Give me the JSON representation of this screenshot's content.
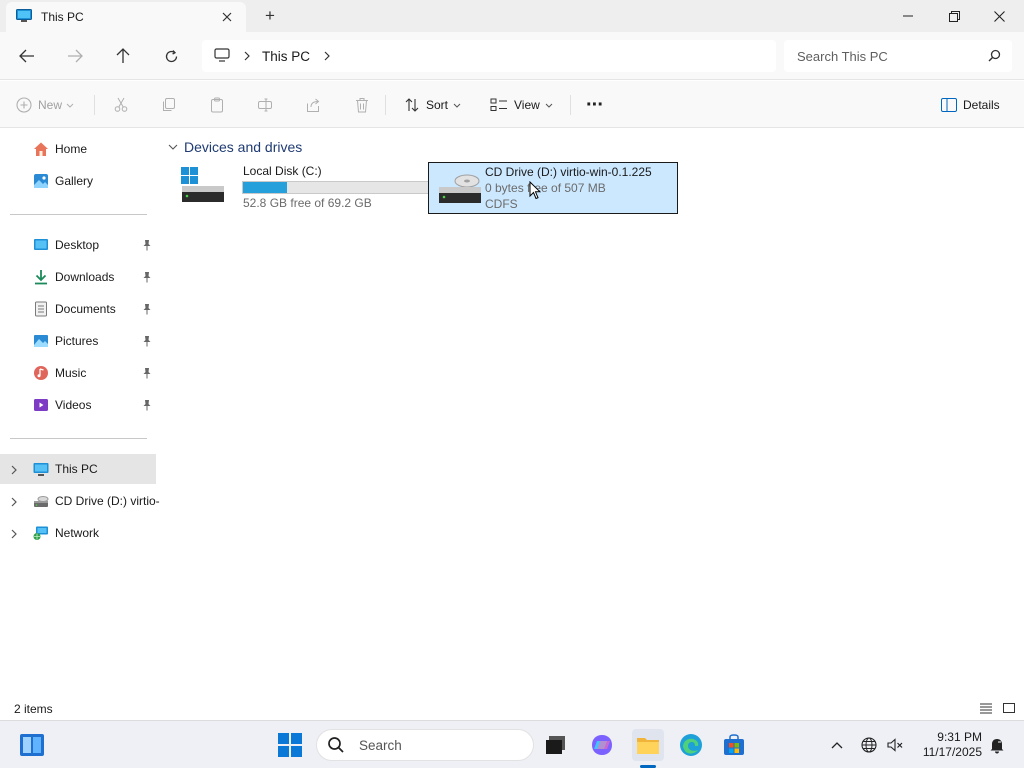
{
  "window": {
    "tab_title": "This PC",
    "new_tab_symbol": "+"
  },
  "address": {
    "crumbs": [
      "This PC"
    ],
    "search_placeholder": "Search This PC"
  },
  "commands": {
    "new_label": "New",
    "sort_label": "Sort",
    "view_label": "View",
    "more_symbol": "···",
    "details_label": "Details"
  },
  "sidebar": {
    "home": "Home",
    "gallery": "Gallery",
    "pinned": [
      {
        "label": "Desktop",
        "icon": "desktop-icon"
      },
      {
        "label": "Downloads",
        "icon": "downloads-icon"
      },
      {
        "label": "Documents",
        "icon": "documents-icon"
      },
      {
        "label": "Pictures",
        "icon": "pictures-icon"
      },
      {
        "label": "Music",
        "icon": "music-icon"
      },
      {
        "label": "Videos",
        "icon": "videos-icon"
      }
    ],
    "this_pc": "This PC",
    "cd_drive": "CD Drive (D:) virtio-",
    "network": "Network"
  },
  "main": {
    "group_title": "Devices and drives",
    "drives": [
      {
        "name": "Local Disk (C:)",
        "free_text": "52.8 GB free of 69.2 GB",
        "used_fraction": 0.237
      },
      {
        "name": "CD Drive (D:) virtio-win-0.1.225",
        "free_text": "0 bytes free of 507 MB",
        "fs": "CDFS"
      }
    ]
  },
  "status": {
    "items_text": "2 items"
  },
  "taskbar": {
    "search_label": "Search",
    "time": "9:31 PM",
    "date": "11/17/2025"
  },
  "colors": {
    "accent": "#0067c0",
    "selection": "#cce8ff",
    "drive_bar": "#26a0da"
  }
}
